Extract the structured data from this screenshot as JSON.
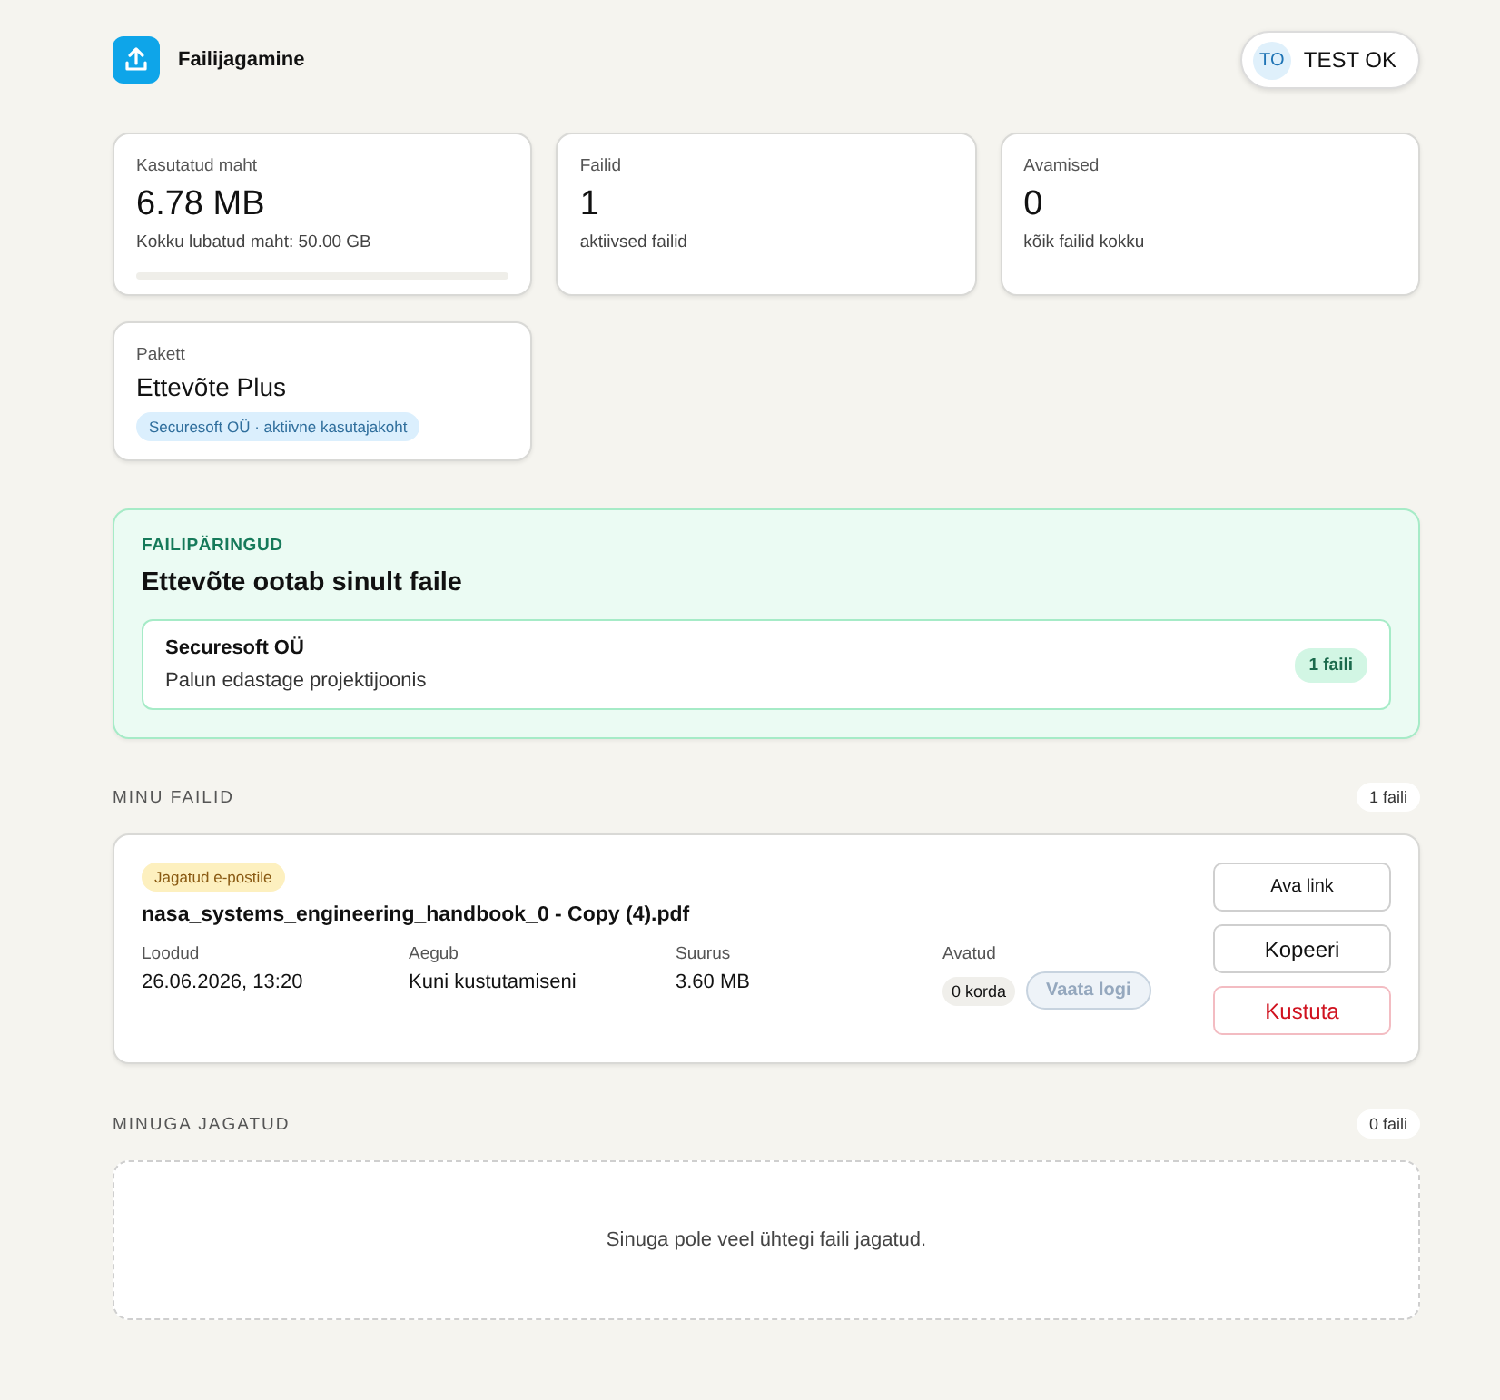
{
  "app": {
    "title": "Failijagamine"
  },
  "user": {
    "initials": "TO",
    "name": "TEST OK"
  },
  "stats": [
    {
      "kind": "meter",
      "label": "Kasutatud maht",
      "value": "6.78 MB",
      "note": "Kokku lubatud maht: 50.00 GB",
      "level": 0.0001
    },
    {
      "kind": "number",
      "label": "Failid",
      "value": "1",
      "note": "aktiivsed failid"
    },
    {
      "kind": "number",
      "label": "Avamised",
      "value": "0",
      "note": "kõik failid kokku"
    },
    {
      "kind": "plan",
      "label": "Pakett",
      "value": "Ettevõte Plus",
      "tag": "Securesoft OÜ · aktiivne kasutajakoht"
    }
  ],
  "requests": {
    "label": "FAILIPÄRINGUD",
    "title": "Ettevõte ootab sinult faile",
    "items": [
      {
        "company": "Securesoft OÜ",
        "message": "Palun edastage projektijoonis",
        "count": "1 faili"
      }
    ]
  },
  "my_files": {
    "title": "MINU FAILID",
    "count": "1 faili",
    "files": [
      {
        "tag": "Jagatud e-postile",
        "name": "nasa_systems_engineering_handbook_0 - Copy (4).pdf",
        "fields": [
          {
            "label": "Loodud",
            "value": "26.06.2026, 13:20"
          },
          {
            "label": "Aegub",
            "value": "Kuni kustutamiseni"
          },
          {
            "label": "Suurus",
            "value": "3.60 MB"
          }
        ],
        "opened": {
          "label": "Avatud",
          "count": "0 korda",
          "log_button": {
            "label": "Vaata logi",
            "disabled": true
          }
        },
        "actions": [
          {
            "kind": "link",
            "label": "Ava link"
          },
          {
            "kind": "copy",
            "label": "Kopeeri"
          },
          {
            "kind": "danger",
            "label": "Kustuta"
          }
        ]
      }
    ]
  },
  "shared": {
    "title": "MINUGA JAGATUD",
    "count": "0 faili",
    "empty_text": "Sinuga pole veel ühtegi faili jagatud."
  }
}
